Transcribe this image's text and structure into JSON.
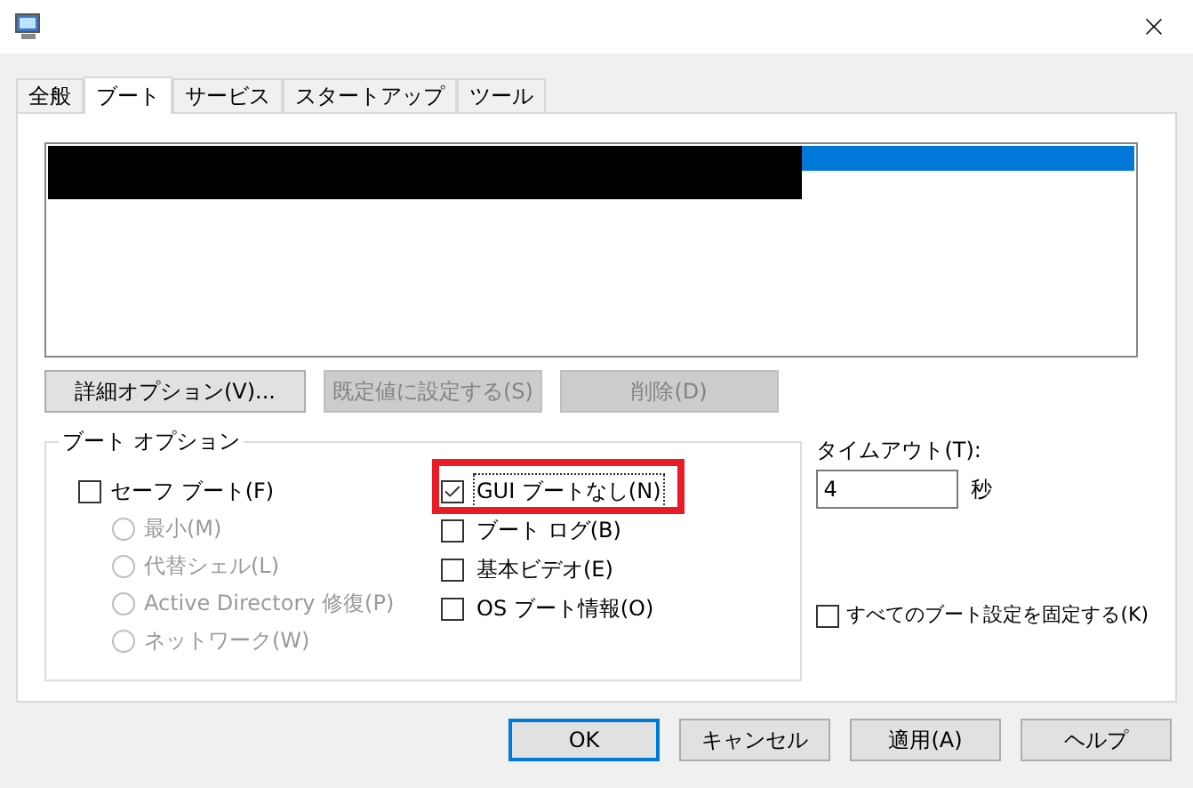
{
  "tabs": [
    {
      "label": "全般",
      "selected": false
    },
    {
      "label": "ブート",
      "selected": true
    },
    {
      "label": "サービス",
      "selected": false
    },
    {
      "label": "スタートアップ",
      "selected": false
    },
    {
      "label": "ツール",
      "selected": false
    }
  ],
  "boot_entries": [
    {
      "selected": true,
      "redacted": true
    }
  ],
  "entry_buttons": [
    {
      "label": "詳細オプション(V)...",
      "disabled": false
    },
    {
      "label": "既定値に設定する(S)",
      "disabled": true
    },
    {
      "label": "削除(D)",
      "disabled": true
    }
  ],
  "boot_options": {
    "title": "ブート オプション",
    "safe_boot": {
      "label": "セーフ ブート(F)",
      "checked": false
    },
    "safe_modes": [
      {
        "label": "最小(M)",
        "selected": false,
        "disabled": true
      },
      {
        "label": "代替シェル(L)",
        "selected": false,
        "disabled": true
      },
      {
        "label": "Active Directory 修復(P)",
        "selected": false,
        "disabled": true
      },
      {
        "label": "ネットワーク(W)",
        "selected": false,
        "disabled": true
      }
    ],
    "options": [
      {
        "label": "GUI ブートなし(N)",
        "checked": true,
        "focused": true,
        "highlighted": true
      },
      {
        "label": "ブート ログ(B)",
        "checked": false,
        "focused": false,
        "highlighted": false
      },
      {
        "label": "基本ビデオ(E)",
        "checked": false,
        "focused": false,
        "highlighted": false
      },
      {
        "label": "OS ブート情報(O)",
        "checked": false,
        "focused": false,
        "highlighted": false
      }
    ]
  },
  "timeout": {
    "label": "タイムアウト(T):",
    "value": "4",
    "unit": "秒"
  },
  "make_permanent": {
    "label": "すべてのブート設定を固定する(K)",
    "checked": false
  },
  "buttons": [
    {
      "label": "OK",
      "default": true
    },
    {
      "label": "キャンセル",
      "default": false
    },
    {
      "label": "適用(A)",
      "default": false
    },
    {
      "label": "ヘルプ",
      "default": false
    }
  ]
}
